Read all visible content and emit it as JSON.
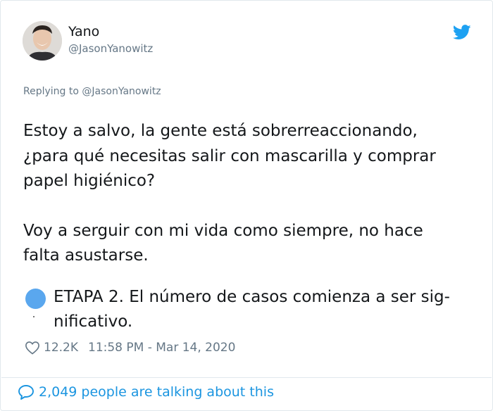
{
  "tweet": {
    "author_name": "Yano",
    "author_handle": "@JasonYanowitz",
    "replying_prefix": "Replying to ",
    "replying_handle": "@JasonYanowitz",
    "paragraphs": [
      "Estoy a salvo, la gente está sobrerreaccionando,\n¿para qué necesitas salir con mascarilla y comprar\npapel higiénico?",
      "Voy a serguir con mi vida como siempre, no hace\nfalta asustarse."
    ],
    "etapa_text": "ETAPA 2. El número de casos comienza a ser sig-\nnificativo.",
    "likes": "12.2K",
    "timestamp": "11:58 PM - Mar 14, 2020",
    "talking": "2,049 people are talking about this"
  },
  "icons": {
    "brand": "twitter-bird-icon",
    "like": "heart-icon",
    "reply": "speech-bubble-icon",
    "stage": "blue-circle-icon"
  },
  "colors": {
    "brand_blue": "#1da1f2",
    "link_blue": "#1b95e0",
    "muted_gray": "#657786",
    "text_dark": "#14171a",
    "stage_dot": "#5aa7ee"
  }
}
